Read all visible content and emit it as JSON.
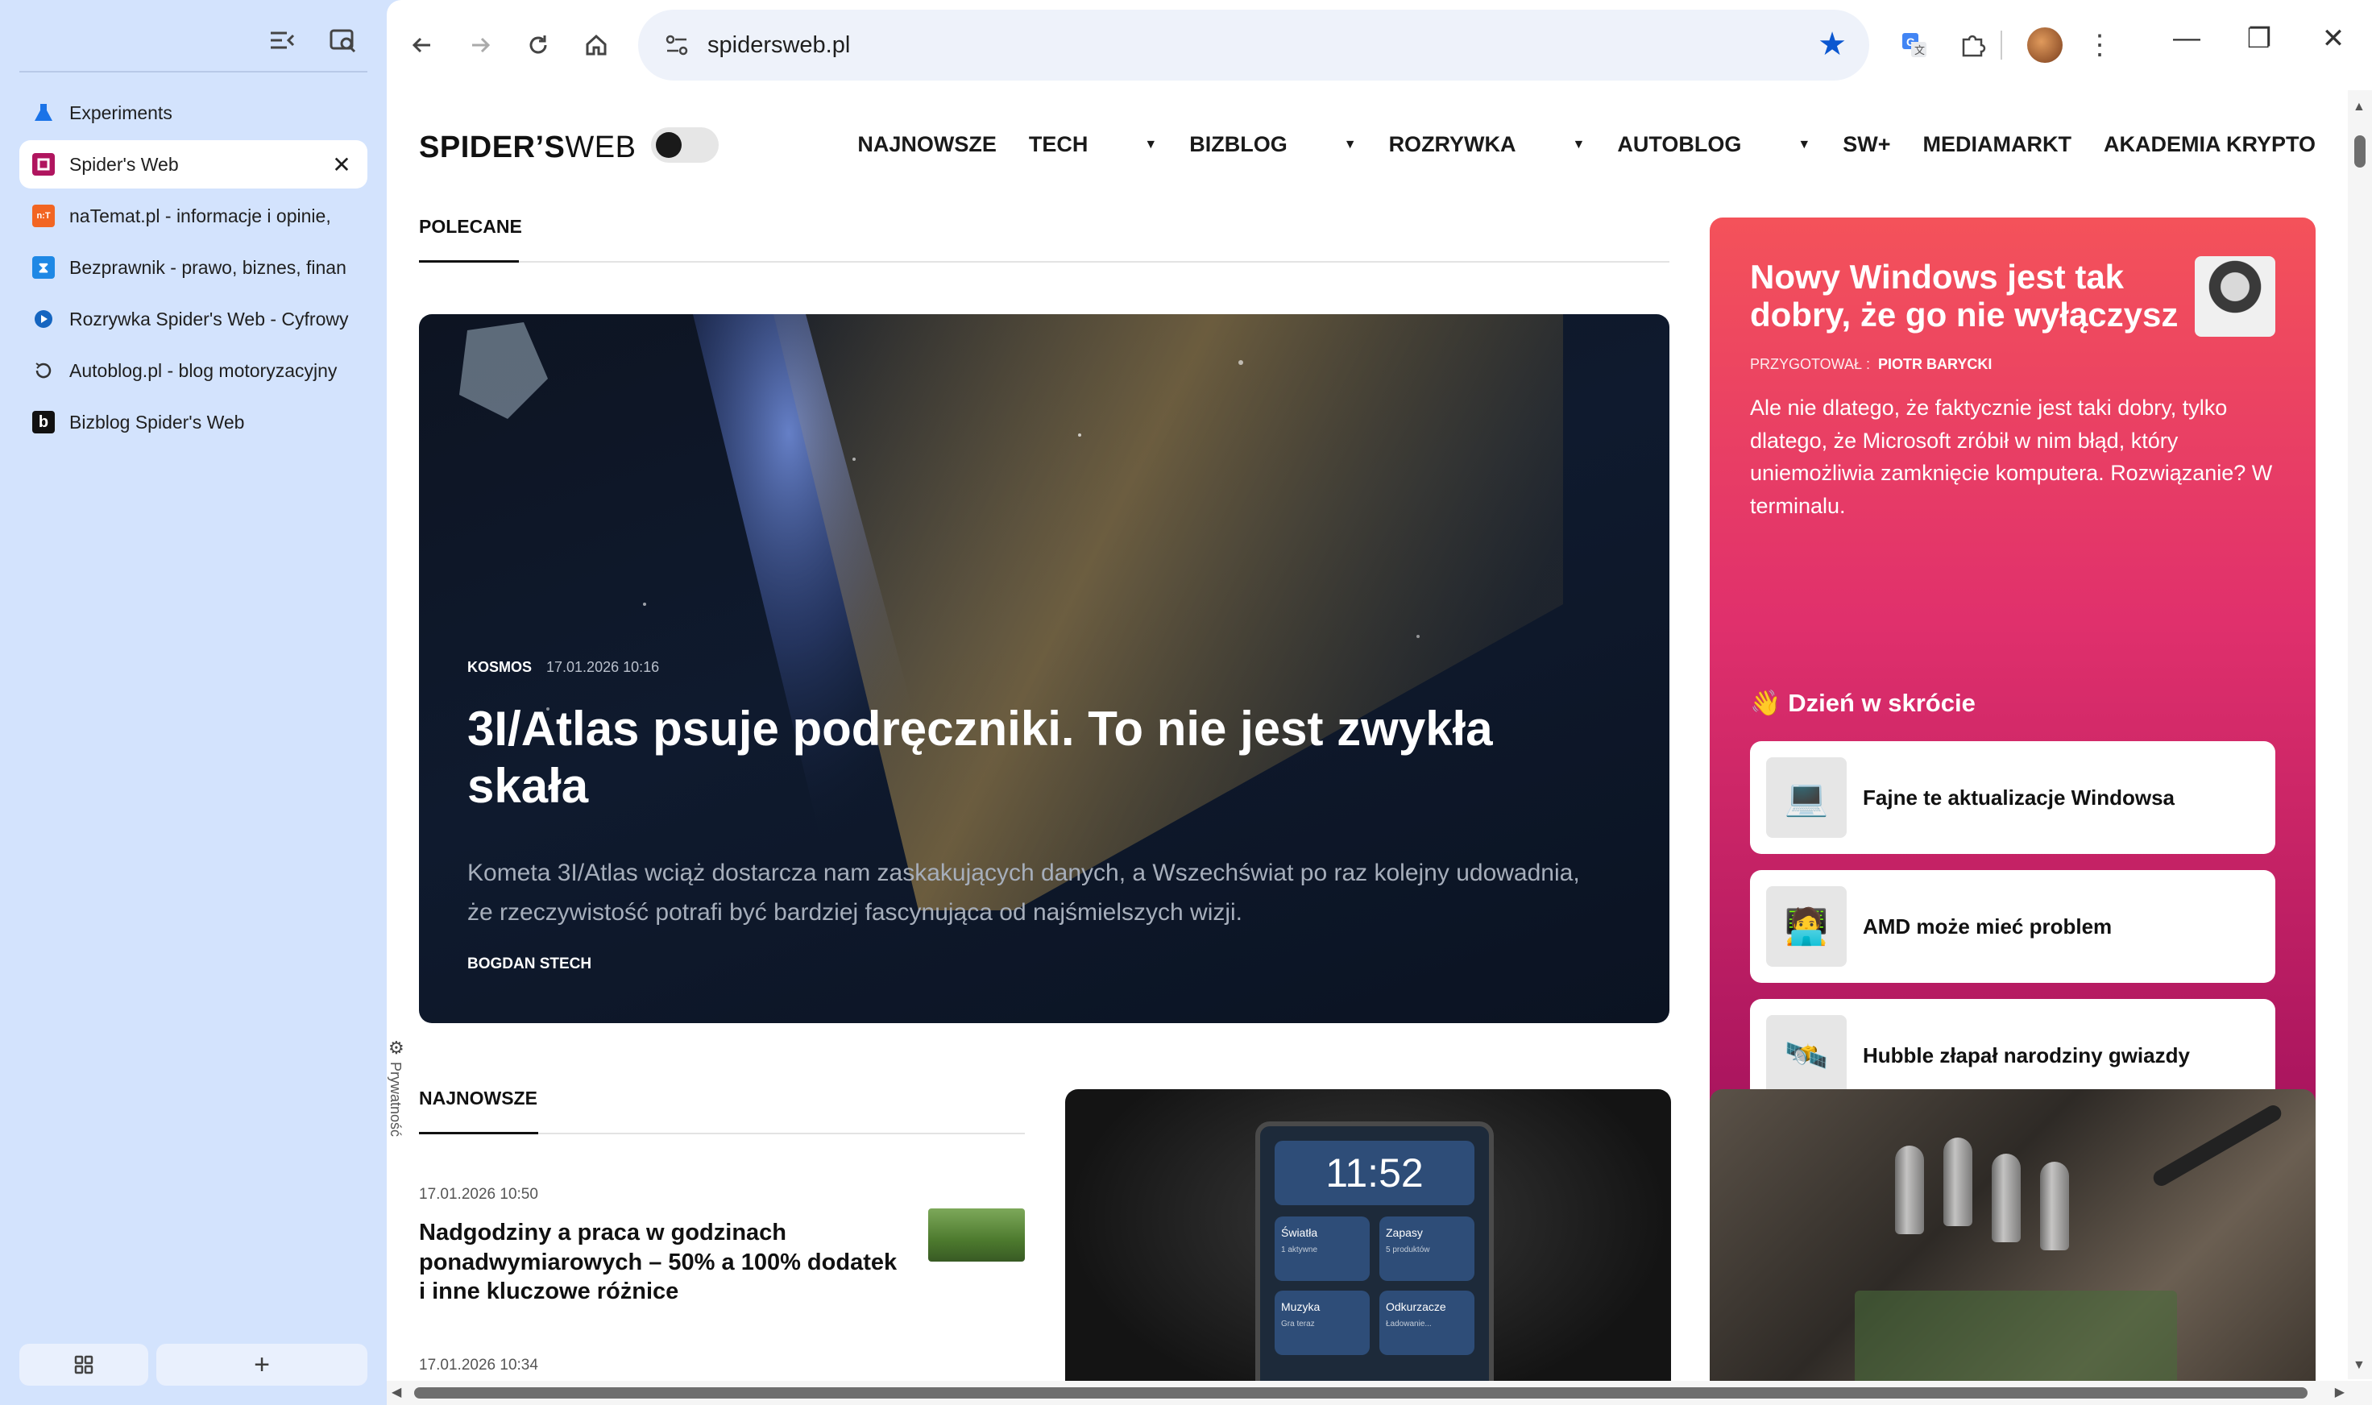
{
  "sidebar": {
    "tabs": [
      {
        "title": "Experiments",
        "favicon": "flask-icon",
        "active": false
      },
      {
        "title": "Spider's Web",
        "favicon": "spidersweb-icon",
        "active": true
      },
      {
        "title": "naTemat.pl - informacje i opinie,",
        "favicon": "natemat-icon",
        "active": false
      },
      {
        "title": "Bezprawnik - prawo, biznes, finan",
        "favicon": "bezprawnik-icon",
        "active": false
      },
      {
        "title": "Rozrywka Spider's Web - Cyfrowy",
        "favicon": "rozrywka-icon",
        "active": false
      },
      {
        "title": "Autoblog.pl - blog motoryzacyjny",
        "favicon": "autoblog-icon",
        "active": false
      },
      {
        "title": "Bizblog Spider's Web",
        "favicon": "bizblog-icon",
        "active": false
      }
    ],
    "bottom": {
      "grid_icon": "grid-icon",
      "plus_label": "+"
    }
  },
  "toolbar": {
    "url": "spidersweb.pl",
    "bookmarked": true,
    "accent": "#0b57d0"
  },
  "site": {
    "logo_bold": "SPIDER’S",
    "logo_thin": "WEB",
    "nav": [
      "NAJNOWSZE",
      "TECH",
      "BIZBLOG",
      "ROZRYWKA",
      "AUTOBLOG",
      "SW+",
      "MEDIAMARKT",
      "AKADEMIA KRYPTO"
    ],
    "nav_with_caret": [
      false,
      true,
      true,
      true,
      true,
      false,
      false,
      false
    ],
    "polecane_label": "POLECANE",
    "najnowsze_label": "NAJNOWSZE",
    "privacy_label": "Prywatność"
  },
  "hero": {
    "category": "KOSMOS",
    "date": "17.01.2026 10:16",
    "title": "3I/Atlas psuje podręczniki. To nie jest zwykła skała",
    "lead": "Kometa 3I/Atlas wciąż dostarcza nam zaskakujących danych, a Wszechświat po raz kolejny udowadnia, że rzeczywistość potrafi być bardziej fascynująca od najśmielszych wizji.",
    "author": "BOGDAN STECH"
  },
  "promo": {
    "title": "Nowy Windows jest tak dobry, że go nie wyłączysz",
    "by_label": "PRZYGOTOWAŁ :",
    "by_name": "PIOTR BARYCKI",
    "lead": "Ale nie dlatego, że faktycznie jest taki dobry, tylko dlatego, że Microsoft zrόbił w nim błąd, który uniemożliwia zamknięcie komputera. Rozwiązanie? W terminalu.",
    "subheading_emoji": "👋",
    "subheading": "Dzień w skrócie",
    "cards": [
      {
        "icon": "💻",
        "text": "Fajne te aktualizacje Windowsa"
      },
      {
        "icon": "🧑‍💻",
        "text": "AMD może mieć problem"
      },
      {
        "icon": "🛰️",
        "text": "Hubble złapał narodziny gwiazdy"
      }
    ],
    "colors": {
      "top": "#f4525a",
      "bottom": "#a8145e"
    }
  },
  "latest": [
    {
      "date": "17.01.2026 10:50",
      "title": "Nadgodziny a praca w godzinach ponadwymiarowych – 50% a 100% dodatek i inne kluczowe różnice"
    },
    {
      "date": "17.01.2026 10:34",
      "title": ""
    }
  ],
  "device_card": {
    "clock": "11:52",
    "tiles": [
      "Światła",
      "Zapasy",
      "Muzyka",
      "Odkurzacze"
    ],
    "tile_subs": [
      "1 aktywne",
      "5 produktów",
      "Gra teraz",
      "Ładowanie..."
    ]
  }
}
